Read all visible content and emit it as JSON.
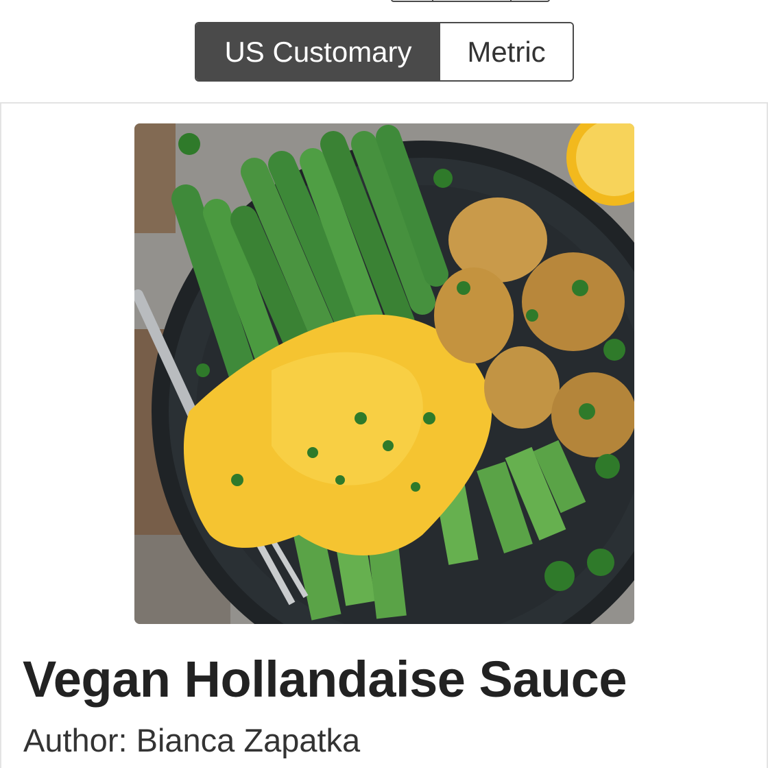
{
  "unit_toggle": {
    "us_label": "US Customary",
    "metric_label": "Metric",
    "selected": "US Customary"
  },
  "recipe": {
    "title": "Vegan Hollandaise Sauce",
    "author_prefix": "Author:",
    "author_name": "Bianca Zapatka"
  },
  "colors": {
    "toggle_active_bg": "#4a4a4a",
    "title_color": "#222222",
    "sauce": "#f5c431",
    "asparagus": "#3f8a3a",
    "plate": "#1f2326"
  }
}
